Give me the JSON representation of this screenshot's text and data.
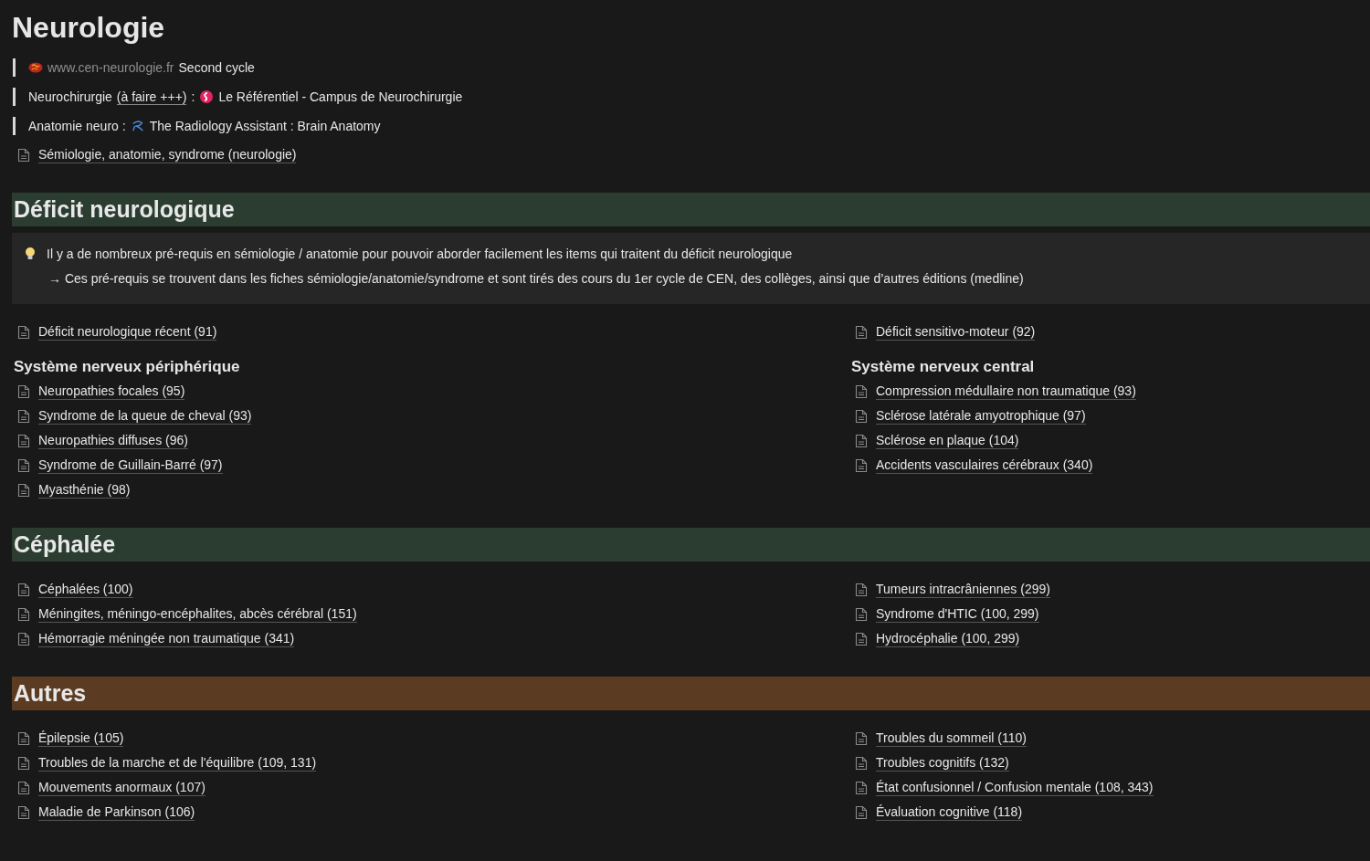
{
  "title": "Neurologie",
  "quotes": [
    {
      "parts": [
        {
          "kind": "brain-logo"
        },
        {
          "kind": "muted",
          "text": "www.cen-neurologie.fr"
        },
        {
          "kind": "text",
          "text": "Second cycle"
        }
      ]
    },
    {
      "parts": [
        {
          "kind": "text",
          "text": "Neurochirurgie"
        },
        {
          "kind": "underlined",
          "text": "(à faire +++)"
        },
        {
          "kind": "text",
          "text": ":"
        },
        {
          "kind": "swirl-logo"
        },
        {
          "kind": "text",
          "text": "Le Référentiel - Campus de Neurochirurgie"
        }
      ]
    },
    {
      "parts": [
        {
          "kind": "text",
          "text": "Anatomie neuro :"
        },
        {
          "kind": "r-logo"
        },
        {
          "kind": "text",
          "text": "The Radiology Assistant : Brain Anatomy"
        }
      ]
    }
  ],
  "page_link": "Sémiologie, anatomie, syndrome (neurologie)",
  "sections": [
    {
      "heading": "Déficit neurologique",
      "color": "#2b3d31",
      "callout": {
        "lines": [
          "Il y a de nombreux pré-requis en sémiologie / anatomie pour pouvoir aborder facilement les items qui traitent du déficit neurologique",
          "→ Ces pré-requis se trouvent dans les fiches sémiologie/anatomie/syndrome et sont tirés des cours du 1er cycle de CEN, des collèges, ainsi que d’autres éditions (medline)"
        ]
      },
      "columns": [
        [
          {
            "kind": "page",
            "text": "Déficit neurologique récent (91)"
          },
          {
            "kind": "heading",
            "text": "Système nerveux périphérique"
          },
          {
            "kind": "page",
            "text": "Neuropathies focales (95)"
          },
          {
            "kind": "page",
            "text": "Syndrome de la queue de cheval (93)"
          },
          {
            "kind": "page",
            "text": "Neuropathies diffuses (96)"
          },
          {
            "kind": "page",
            "text": "Syndrome de Guillain-Barré (97)"
          },
          {
            "kind": "page",
            "text": "Myasthénie (98)"
          }
        ],
        [
          {
            "kind": "page",
            "text": "Déficit sensitivo-moteur (92)"
          },
          {
            "kind": "heading",
            "text": "Système nerveux central"
          },
          {
            "kind": "page",
            "text": "Compression médullaire non traumatique (93)"
          },
          {
            "kind": "page",
            "text": "Sclérose latérale amyotrophique (97)"
          },
          {
            "kind": "page",
            "text": "Sclérose en plaque (104)"
          },
          {
            "kind": "page",
            "text": "Accidents vasculaires cérébraux (340)"
          }
        ]
      ]
    },
    {
      "heading": "Céphalée",
      "color": "#2b3d31",
      "columns": [
        [
          {
            "kind": "page",
            "text": "Céphalées (100)"
          },
          {
            "kind": "page",
            "text": "Méningites, méningo-encéphalites, abcès cérébral (151)"
          },
          {
            "kind": "page",
            "text": "Hémorragie méningée non traumatique (341)"
          }
        ],
        [
          {
            "kind": "page",
            "text": "Tumeurs intracrâniennes (299)"
          },
          {
            "kind": "page",
            "text": "Syndrome d'HTIC (100, 299)"
          },
          {
            "kind": "page",
            "text": "Hydrocéphalie (100, 299)"
          }
        ]
      ]
    },
    {
      "heading": "Autres",
      "color": "#5b3b22",
      "columns": [
        [
          {
            "kind": "page",
            "text": "Épilepsie (105)"
          },
          {
            "kind": "page",
            "text": "Troubles de la marche et de l'équilibre (109, 131)"
          },
          {
            "kind": "page",
            "text": "Mouvements anormaux (107)"
          },
          {
            "kind": "page",
            "text": "Maladie de Parkinson (106)"
          }
        ],
        [
          {
            "kind": "page",
            "text": "Troubles du sommeil (110)"
          },
          {
            "kind": "page",
            "text": "Troubles cognitifs (132)"
          },
          {
            "kind": "page",
            "text": "État confusionnel / Confusion mentale (108, 343)"
          },
          {
            "kind": "page",
            "text": "Évaluation cognitive (118)"
          }
        ]
      ]
    }
  ]
}
